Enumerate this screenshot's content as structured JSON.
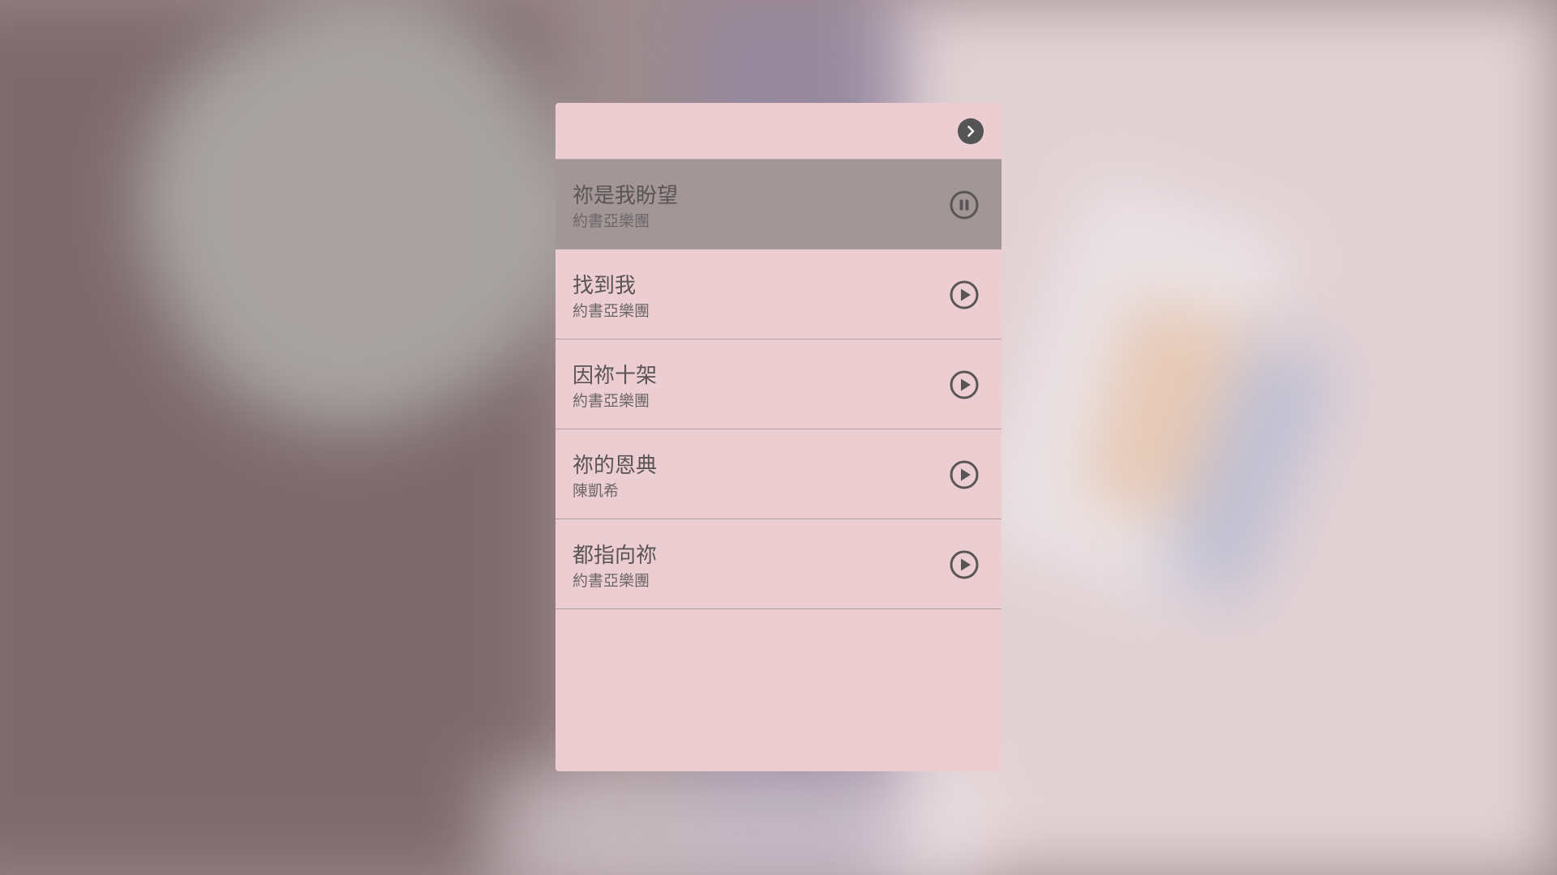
{
  "player": {
    "next_icon": "chevron-right-circle-icon",
    "colors": {
      "panel_bg": "#ecced2",
      "active_row_bg": "#a39696",
      "icon": "#595556",
      "text": "#5a5457"
    },
    "tracks": [
      {
        "title": "祢是我盼望",
        "artist": "約書亞樂團",
        "state": "playing",
        "icon": "pause-circle-icon"
      },
      {
        "title": "找到我",
        "artist": "約書亞樂團",
        "state": "idle",
        "icon": "play-circle-icon"
      },
      {
        "title": "因祢十架",
        "artist": "約書亞樂團",
        "state": "idle",
        "icon": "play-circle-icon"
      },
      {
        "title": "祢的恩典",
        "artist": "陳凱希",
        "state": "idle",
        "icon": "play-circle-icon"
      },
      {
        "title": "都指向祢",
        "artist": "約書亞樂團",
        "state": "idle",
        "icon": "play-circle-icon"
      }
    ]
  }
}
